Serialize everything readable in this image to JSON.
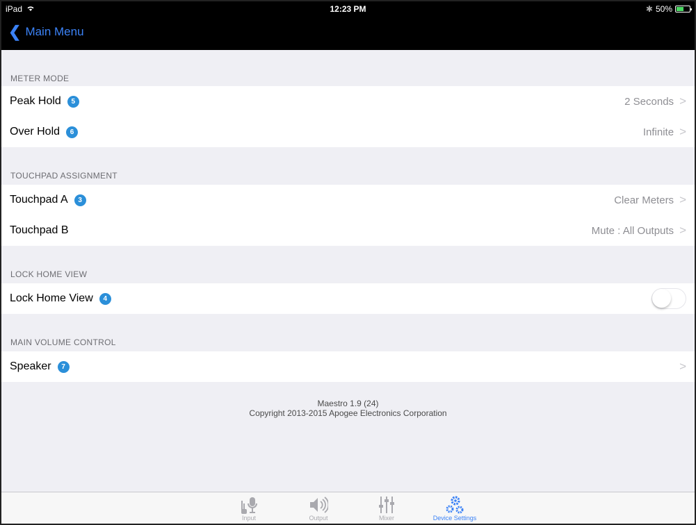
{
  "status": {
    "device": "iPad",
    "time": "12:23 PM",
    "battery": "50%"
  },
  "nav": {
    "back_label": "Main Menu"
  },
  "sections": [
    {
      "header": "METER MODE",
      "rows": [
        {
          "label": "Peak Hold",
          "badge": "5",
          "value": "2 Seconds"
        },
        {
          "label": "Over Hold",
          "badge": "6",
          "value": "Infinite"
        }
      ]
    },
    {
      "header": "TOUCHPAD ASSIGNMENT",
      "rows": [
        {
          "label": "Touchpad A",
          "badge": "3",
          "value": "Clear Meters"
        },
        {
          "label": "Touchpad B",
          "value": "Mute : All Outputs"
        }
      ]
    },
    {
      "header": "LOCK HOME VIEW",
      "rows": [
        {
          "label": "Lock Home View",
          "badge": "4",
          "toggle": false
        }
      ]
    },
    {
      "header": "MAIN VOLUME CONTROL",
      "rows": [
        {
          "label": "Speaker",
          "badge": "7",
          "value": ""
        }
      ]
    }
  ],
  "footer": {
    "line1": "Maestro 1.9 (24)",
    "line2": "Copyright 2013-2015 Apogee Electronics Corporation"
  },
  "tabs": [
    {
      "label": "Input",
      "icon": "input-icon"
    },
    {
      "label": "Output",
      "icon": "speaker-icon"
    },
    {
      "label": "Mixer",
      "icon": "mixer-icon"
    },
    {
      "label": "Device Settings",
      "icon": "gears-icon",
      "active": true
    }
  ],
  "colors": {
    "accent": "#3b82f6",
    "badge": "#2b8fd9",
    "background": "#efeff4"
  }
}
